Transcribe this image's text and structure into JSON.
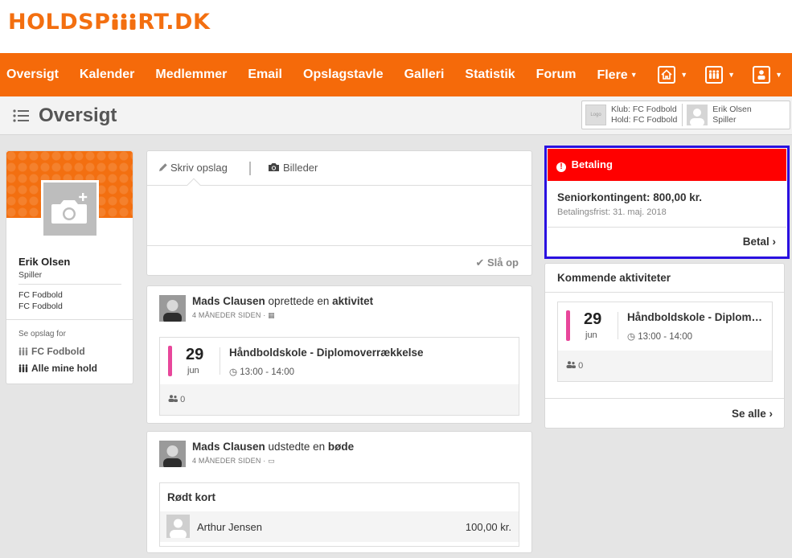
{
  "brand": {
    "logo_text_1": "HOLDSP",
    "logo_text_2": "RT.DK",
    "color": "#f56a0a"
  },
  "nav": {
    "items": [
      {
        "label": "Oversigt"
      },
      {
        "label": "Kalender"
      },
      {
        "label": "Medlemmer"
      },
      {
        "label": "Email"
      },
      {
        "label": "Opslagstavle"
      },
      {
        "label": "Galleri"
      },
      {
        "label": "Statistik"
      },
      {
        "label": "Forum"
      },
      {
        "label": "Flere"
      }
    ],
    "right_icons": [
      "home-icon",
      "team-icon",
      "user-icon"
    ]
  },
  "page": {
    "title": "Oversigt"
  },
  "context": {
    "logo_label": "Logo",
    "club_line": "Klub: FC Fodbold",
    "team_line": "Hold: FC Fodbold",
    "user_name": "Erik Olsen",
    "user_role": "Spiller"
  },
  "profile": {
    "name": "Erik Olsen",
    "role": "Spiller",
    "club": "FC Fodbold",
    "team": "FC Fodbold",
    "see_posts_label": "Se opslag for",
    "filter_club": "FC Fodbold",
    "filter_all": "Alle mine hold"
  },
  "composer": {
    "tab_write": "Skriv opslag",
    "tab_images": "Billeder",
    "post_button": "Slå op"
  },
  "feed": [
    {
      "author": "Mads Clausen",
      "action": "oprettede en",
      "object": "aktivitet",
      "time": "4 MÅNEDER SIDEN",
      "activity": {
        "day": "29",
        "month": "jun",
        "title": "Håndboldskole - Diplomoverrækkelse",
        "time": "13:00 - 14:00",
        "participants": "0",
        "color": "#e8479b"
      }
    },
    {
      "author": "Mads Clausen",
      "action": "udstedte en",
      "object": "bøde",
      "time": "4 MÅNEDER SIDEN",
      "fine": {
        "title": "Rødt kort",
        "person": "Arthur Jensen",
        "amount": "100,00 kr."
      }
    }
  ],
  "payment": {
    "header": "Betaling",
    "title": "Seniorkontingent: 800,00 kr.",
    "due": "Betalingsfrist: 31. maj. 2018",
    "button": "Betal",
    "header_color": "#ff0000"
  },
  "upcoming": {
    "header": "Kommende aktiviteter",
    "day": "29",
    "month": "jun",
    "title": "Håndboldskole - Diplomo...",
    "time": "13:00 - 14:00",
    "participants": "0",
    "see_all": "Se alle"
  }
}
